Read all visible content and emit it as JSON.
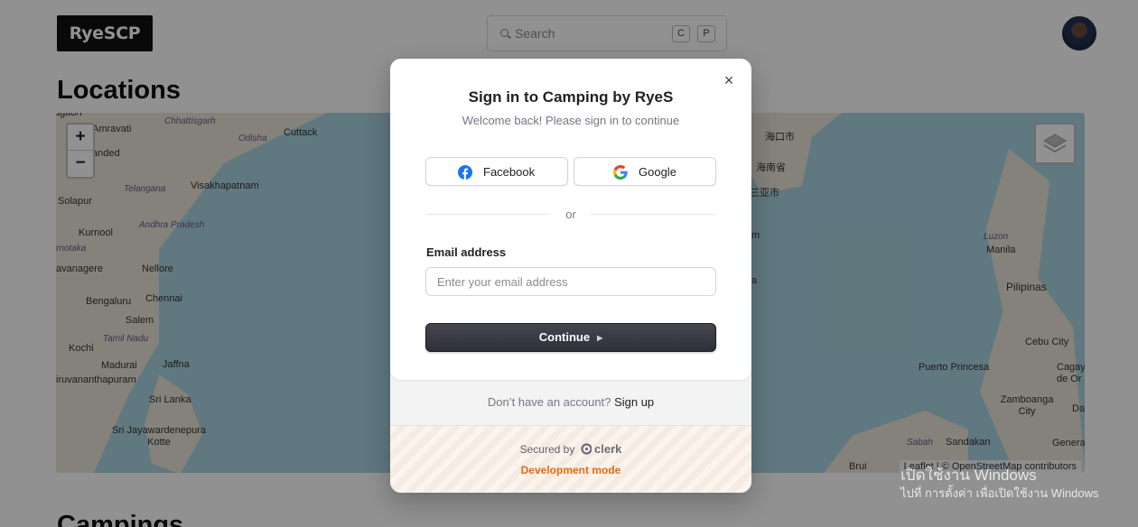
{
  "header": {
    "logo": "RyeSCP",
    "search_placeholder": "Search",
    "shortcut_keys": [
      "C",
      "P"
    ]
  },
  "page": {
    "locations_heading": "Locations",
    "campings_heading": "Campings"
  },
  "map": {
    "zoom_in": "+",
    "zoom_out": "−",
    "labels": [
      "Amravati",
      "Chhattisgarh",
      "Cuttack",
      "Odisha",
      "anded",
      "Telangana",
      "Visakhapatnam",
      "Solapur",
      "Andhra Pradesh",
      "Kurnool",
      "rnotaka",
      "avanagere",
      "Nellore",
      "Bengaluru",
      "Chennai",
      "Salem",
      "Tamil Nadu",
      "Kochi",
      "Madurai",
      "Jaffna",
      "iruvananthapuram",
      "Sri Lanka",
      "Sri Jayawardenepura Kotte",
      "海口市",
      "海南省",
      "三亚市",
      "Luzon",
      "Manila",
      "Pilipinas",
      "Cebu City",
      "Puerto Princesa",
      "Cagay de Or",
      "Zamboanga City",
      "Da",
      "Sabah",
      "Sandakan",
      "Genera",
      "Brui",
      "agaon",
      "m",
      "a"
    ],
    "attribution": "Leaflet | © OpenStreetMap contributors"
  },
  "modal": {
    "close": "×",
    "title": "Sign in to Camping by RyeS",
    "subtitle": "Welcome back! Please sign in to continue",
    "facebook_label": "Facebook",
    "google_label": "Google",
    "or": "or",
    "email_label": "Email address",
    "email_placeholder": "Enter your email address",
    "continue_label": "Continue",
    "signup_prompt": "Don’t have an account?",
    "signup_link": "Sign up",
    "secured_by": "Secured by",
    "clerk": "clerk",
    "dev_mode": "Development mode"
  },
  "watermark": {
    "line1": "เปิดใช้งาน Windows",
    "line2": "ไปที่ การตั้งค่า เพื่อเปิดใช้งาน Windows"
  },
  "colors": {
    "map_water": "#aad3df",
    "map_land": "#e9e4d8",
    "dev_mode": "#e26b16",
    "facebook": "#1877f2"
  }
}
